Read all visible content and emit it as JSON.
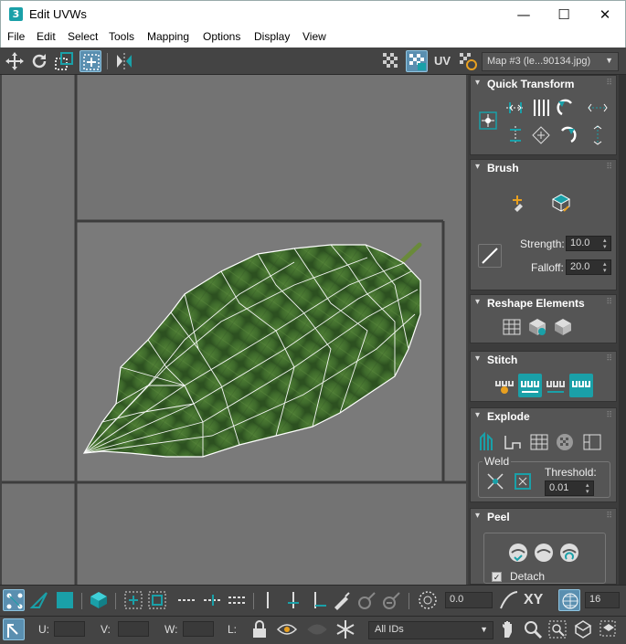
{
  "window": {
    "title": "Edit UVWs",
    "app_icon": "3",
    "min": "—",
    "max": "☐",
    "close": "✕"
  },
  "menus": [
    "File",
    "Edit",
    "Select",
    "Tools",
    "Mapping",
    "Options",
    "Display",
    "View"
  ],
  "toolbar": {
    "uv_label": "UV",
    "map_select": "Map #3 (le...90134.jpg)"
  },
  "panel": {
    "quick_transform": "Quick Transform",
    "brush": {
      "title": "Brush",
      "strength_label": "Strength:",
      "strength_value": "10.0",
      "falloff_label": "Falloff:",
      "falloff_value": "20.0"
    },
    "reshape": "Reshape Elements",
    "stitch": "Stitch",
    "explode": {
      "title": "Explode",
      "weld_label": "Weld",
      "threshold_label": "Threshold:",
      "threshold_value": "0.01"
    },
    "peel": {
      "title": "Peel",
      "detach_label": "Detach"
    }
  },
  "bottom": {
    "angle_value": "0.0",
    "xy_label": "XY",
    "grid_value": "16",
    "u_label": "U:",
    "v_label": "V:",
    "w_label": "W:",
    "l_label": "L:",
    "ids_select": "All IDs"
  },
  "colors": {
    "accent": "#1aa0a8",
    "selected": "#5a8fb0",
    "panel": "#555555",
    "viewport": "#737373",
    "leaf": "#3f6b2c"
  }
}
